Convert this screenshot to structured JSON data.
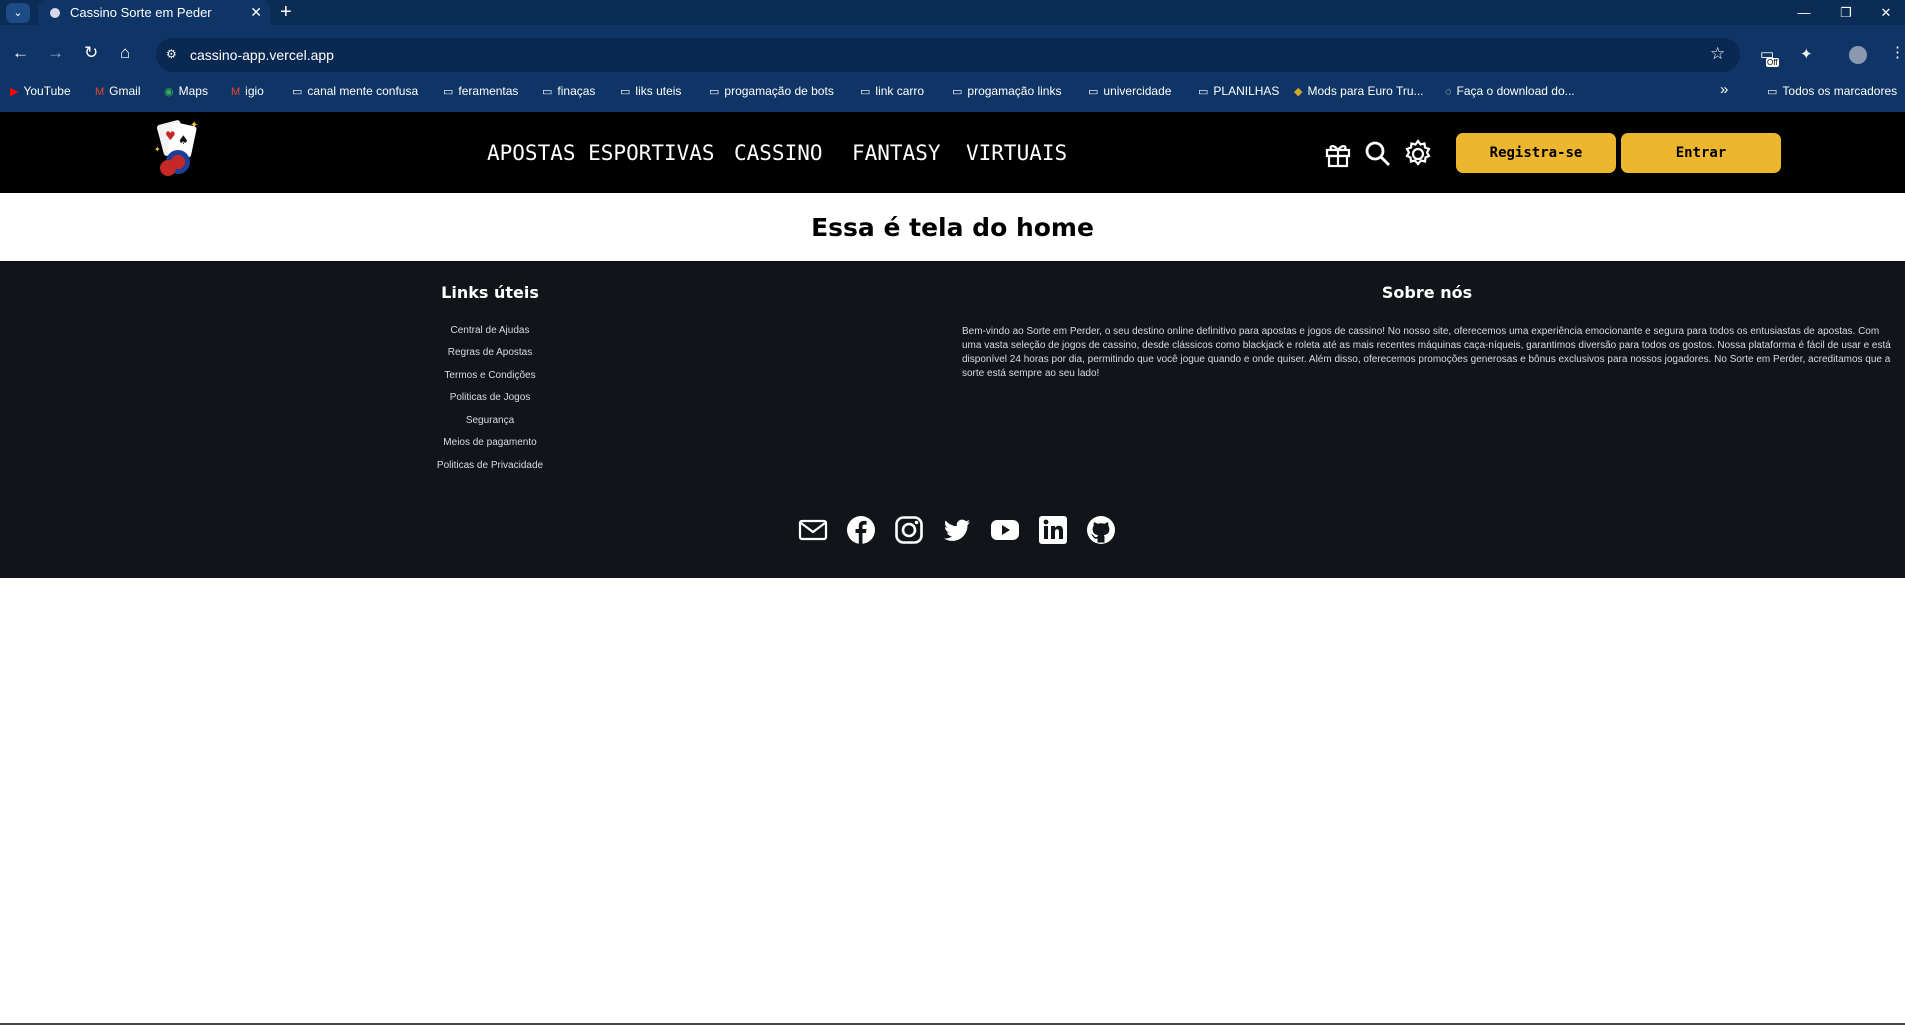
{
  "browser": {
    "tab_title": "Cassino Sorte em Peder",
    "tab_close": "✕",
    "new_tab": "+",
    "url": "cassino-app.vercel.app",
    "window_controls": [
      "—",
      "❐",
      "✕"
    ],
    "extension_badge": "Off",
    "bookmarks": [
      "YouTube",
      "Gmail",
      "Maps",
      "igio",
      "canal mente confusa",
      "feramentas",
      "finaças",
      "liks uteis",
      "progamação de bots",
      "link carro",
      "progamação links",
      "univercidade",
      "PLANILHAS",
      "Mods para Euro Tru...",
      "Faça o download do...",
      "»",
      "Todos os marcadores"
    ]
  },
  "header": {
    "nav": [
      "APOSTAS ESPORTIVAS",
      "CASSINO",
      "FANTASY",
      "VIRTUAIS"
    ],
    "icons": [
      "gift-icon",
      "search-icon",
      "gear-icon"
    ],
    "register_label": "Registra-se",
    "login_label": "Entrar",
    "accent_color": "#ecb62e"
  },
  "main": {
    "title": "Essa é tela do home"
  },
  "footer": {
    "links_heading": "Links úteis",
    "links": [
      "Central de Ajudas",
      "Regras de Apostas",
      "Termos e Condições",
      "Politicas de Jogos",
      "Segurança",
      "Meios de pagamento",
      "Politicas de Privacidade"
    ],
    "about_heading": "Sobre nós",
    "about_text": "Bem-vindo ao Sorte em Perder, o seu destino online definitivo para apostas e jogos de cassino! No nosso site, oferecemos uma experiência emocionante e segura para todos os entusiastas de apostas. Com uma vasta seleção de jogos de cassino, desde clássicos como blackjack e roleta até as mais recentes máquinas caça-níqueis, garantimos diversão para todos os gostos. Nossa plataforma é fácil de usar e está disponível 24 horas por dia, permitindo que você jogue quando e onde quiser. Além disso, oferecemos promoções generosas e bônus exclusivos para nossos jogadores. No Sorte em Perder, acreditamos que a sorte está sempre ao seu lado!",
    "social_icons": [
      "email-icon",
      "facebook-icon",
      "instagram-icon",
      "twitter-icon",
      "youtube-icon",
      "linkedin-icon",
      "github-icon"
    ]
  }
}
